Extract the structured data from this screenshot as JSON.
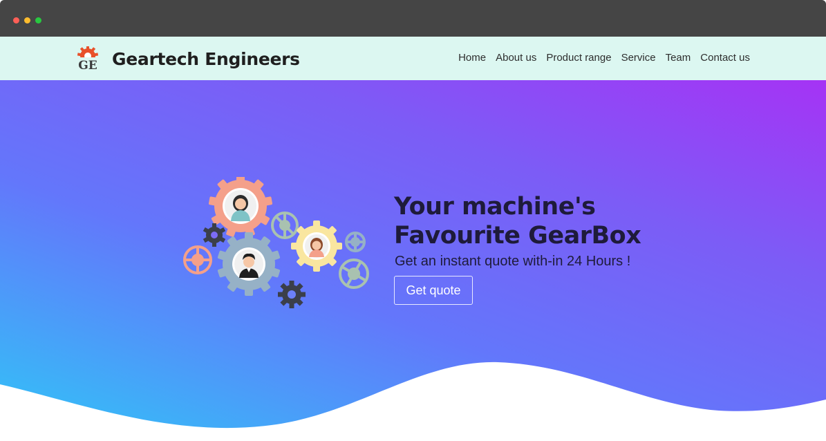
{
  "window": {
    "controls": [
      "close",
      "minimize",
      "maximize"
    ]
  },
  "header": {
    "logo_icon": "gear-logo-icon",
    "logo_text": "GE",
    "brand": "Geartech Engineers",
    "nav": [
      "Home",
      "About us",
      "Product range",
      "Service",
      "Team",
      "Contact us"
    ]
  },
  "hero": {
    "headline_line1": "Your machine's",
    "headline_line2": "Favourite GearBox",
    "subtext": "Get an instant quote with-in 24 Hours !",
    "cta_label": "Get quote",
    "illustration_icon": "team-gears-illustration"
  },
  "colors": {
    "navbar_bg": "#dcf7f1",
    "gradient_top": "#a533f5",
    "gradient_mid": "#6377fb",
    "gradient_bottom": "#2fc7f7",
    "headline": "#1e1b3a",
    "gear_salmon": "#f4a08a",
    "gear_sage": "#a9c2b0",
    "gear_yellow": "#f9e6a0",
    "gear_bluegray": "#96b1c6",
    "gear_dark": "#3b3f4a"
  }
}
